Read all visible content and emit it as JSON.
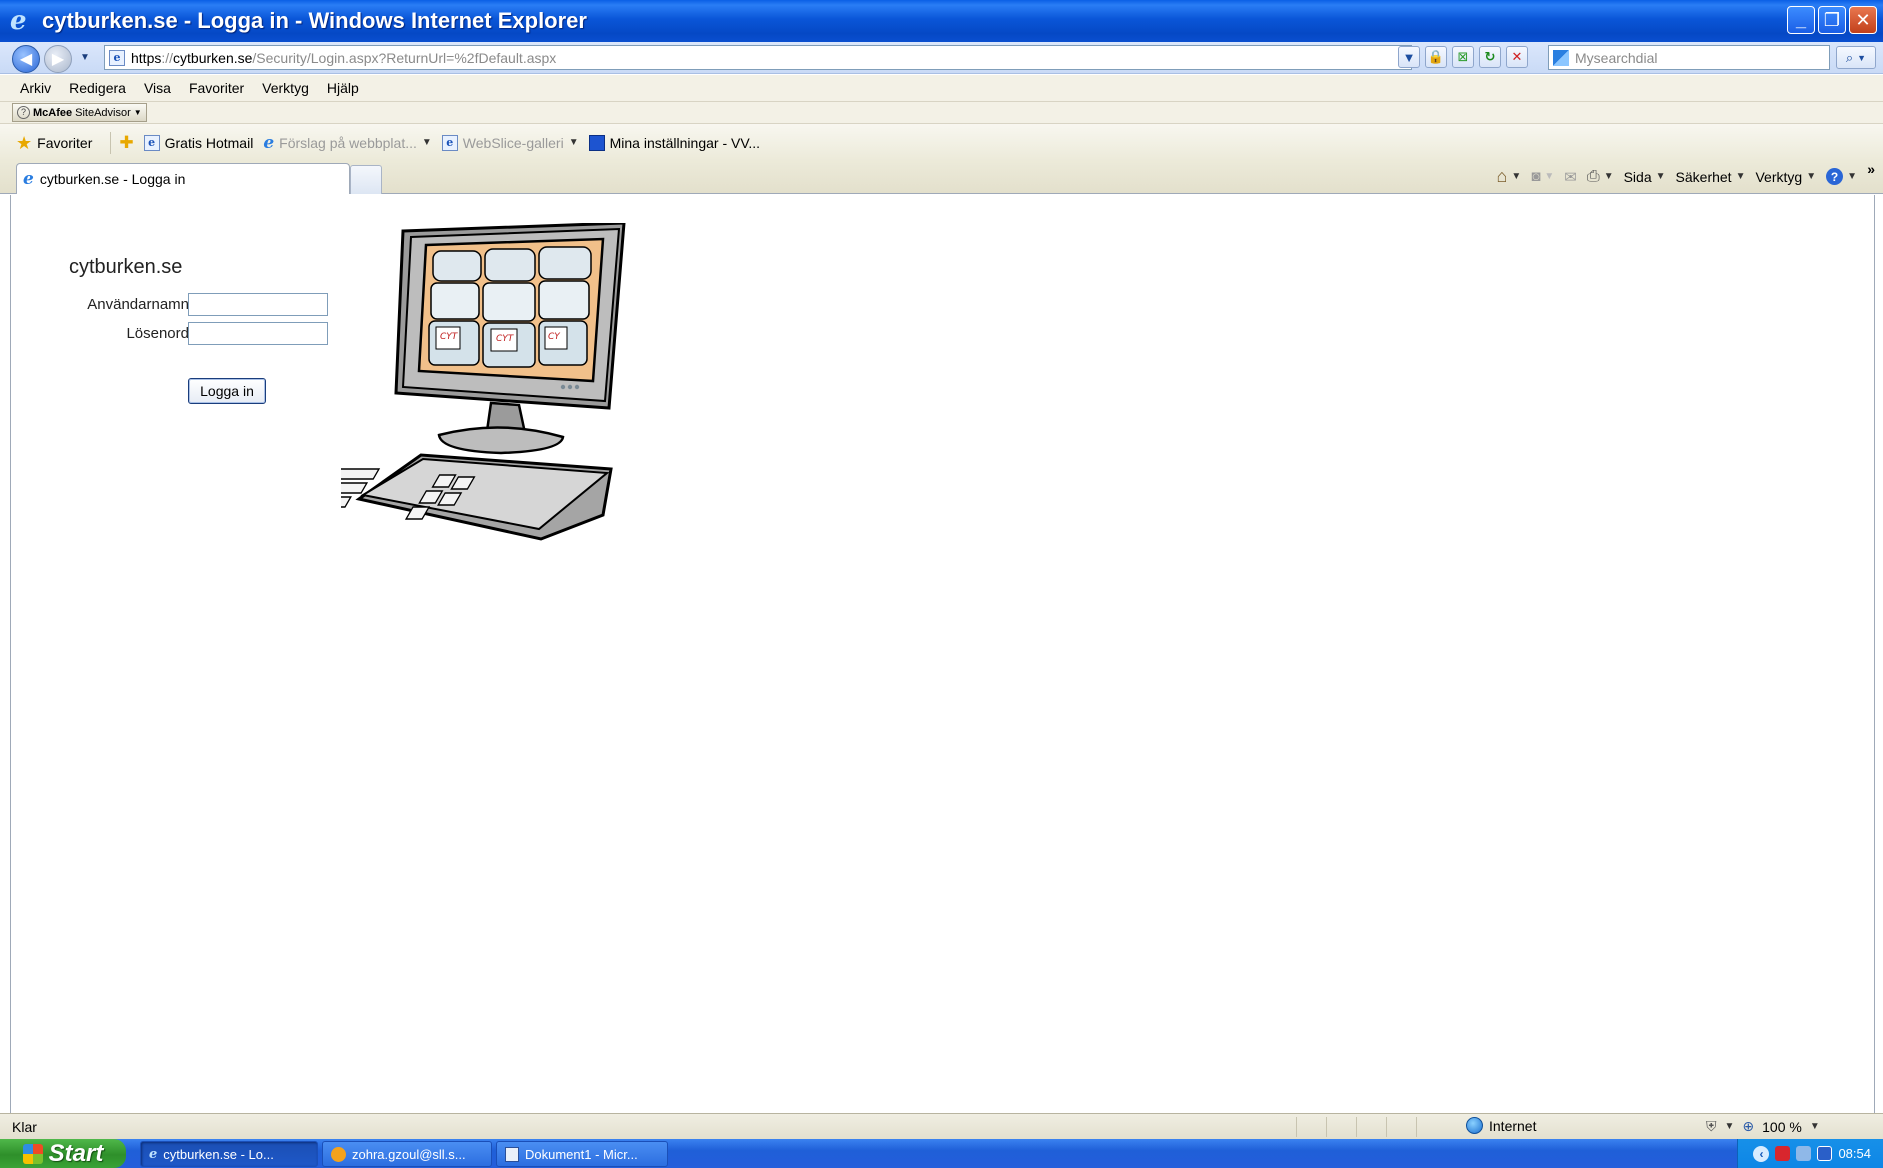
{
  "window": {
    "title": "cytburken.se - Logga in - Windows Internet Explorer",
    "buttons": {
      "minimize": "_",
      "restore": "❐",
      "close": "✕"
    }
  },
  "address_bar": {
    "scheme": "https",
    "separator": "://",
    "domain": "cytburken.se",
    "path": "/Security/Login.aspx?ReturnUrl=%2fDefault.aspx",
    "search_placeholder": "Mysearchdial"
  },
  "menu": [
    "Arkiv",
    "Redigera",
    "Visa",
    "Favoriter",
    "Verktyg",
    "Hjälp"
  ],
  "mcafee": {
    "brand": "McAfee",
    "label": "SiteAdvisor"
  },
  "favorites_bar": {
    "favorites_label": "Favoriter",
    "items": [
      "Gratis Hotmail",
      "Förslag på webbplat...",
      "WebSlice-galleri",
      "Mina inställningar - VV..."
    ]
  },
  "tab": {
    "label": "cytburken.se - Logga in"
  },
  "command_bar": {
    "page": "Sida",
    "safety": "Säkerhet",
    "tools": "Verktyg"
  },
  "login": {
    "site_title": "cytburken.se",
    "username_label": "Användarnamn",
    "password_label": "Lösenord",
    "username_value": "",
    "password_value": "",
    "submit_label": "Logga in"
  },
  "status_bar": {
    "status": "Klar",
    "zone": "Internet",
    "zoom": "100 %"
  },
  "taskbar": {
    "start_label": "Start",
    "items": [
      "cytburken.se - Lo...",
      "zohra.gzoul@sll.s...",
      "Dokument1 - Micr..."
    ],
    "clock": "08:54"
  }
}
